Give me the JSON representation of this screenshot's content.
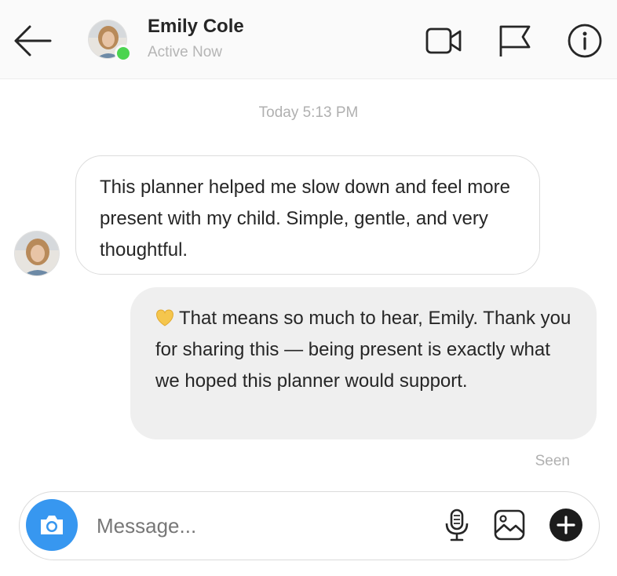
{
  "header": {
    "contact_name": "Emily Cole",
    "status": "Active Now",
    "icons": [
      "back-arrow-icon",
      "video-call-icon",
      "flag-icon",
      "info-icon"
    ]
  },
  "conversation": {
    "timestamp": "Today 5:13 PM",
    "messages": [
      {
        "direction": "incoming",
        "text": "This planner helped me slow down and feel more present with my child. Simple, gentle, and very thoughtful."
      },
      {
        "direction": "outgoing",
        "emoji": "yellow-heart-icon",
        "text": "That means so much to hear, Emily. Thank you for sharing this — being present is exactly what we hoped this planner would support."
      }
    ],
    "seen_label": "Seen"
  },
  "composer": {
    "placeholder": "Message...",
    "icons": [
      "camera-icon",
      "microphone-icon",
      "image-icon",
      "plus-icon"
    ]
  },
  "colors": {
    "accent_blue": "#3797f0",
    "online_green": "#4cd450",
    "outgoing_bubble": "#efefef",
    "muted_text": "#b0b0b0"
  }
}
